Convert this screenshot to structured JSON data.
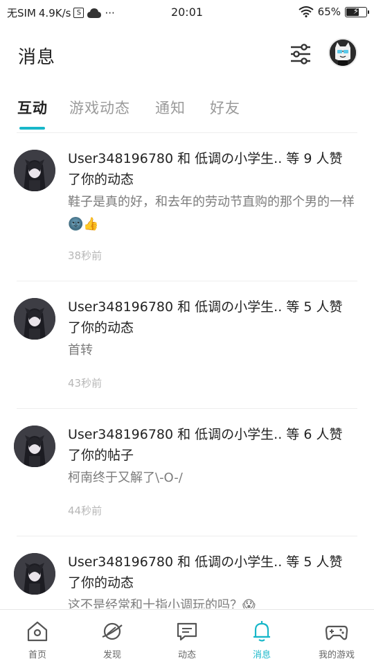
{
  "status_bar": {
    "carrier": "无SIM",
    "speed": "4.9K/s",
    "s_box": "S",
    "dots": "···",
    "time": "20:01",
    "battery_text": "65%",
    "battery_level": 0.65
  },
  "header": {
    "title": "消息"
  },
  "tabs": [
    {
      "label": "互动",
      "active": true
    },
    {
      "label": "游戏动态",
      "active": false
    },
    {
      "label": "通知",
      "active": false
    },
    {
      "label": "好友",
      "active": false
    }
  ],
  "messages": [
    {
      "line1": "User348196780 和 低调の小学生.. 等 9 人赞",
      "line2": "了你的动态",
      "body": "鞋子是真的好，和去年的劳动节直购的那个男的一样🌚👍",
      "time": "38秒前"
    },
    {
      "line1": "User348196780 和 低调の小学生.. 等 5 人赞",
      "line2": "了你的动态",
      "body": "首转",
      "time": "43秒前"
    },
    {
      "line1": "User348196780 和 低调の小学生.. 等 6 人赞",
      "line2": "了你的帖子",
      "body": "柯南终于又解了\\-O-/",
      "time": "44秒前"
    },
    {
      "line1": "User348196780 和 低调の小学生.. 等 5 人赞",
      "line2": "了你的动态",
      "body": "这不是经常和十指小调玩的吗？😱",
      "time": ""
    }
  ],
  "bottom_nav": [
    {
      "label": "首页",
      "icon": "home-icon",
      "active": false
    },
    {
      "label": "发现",
      "icon": "planet-icon",
      "active": false
    },
    {
      "label": "动态",
      "icon": "chat-icon",
      "active": false
    },
    {
      "label": "消息",
      "icon": "bell-icon",
      "active": true
    },
    {
      "label": "我的游戏",
      "icon": "gamepad-icon",
      "active": false
    }
  ],
  "colors": {
    "accent": "#18b7c9",
    "text": "#222222",
    "secondary": "#7c7c7c",
    "muted": "#b7b7b7"
  }
}
